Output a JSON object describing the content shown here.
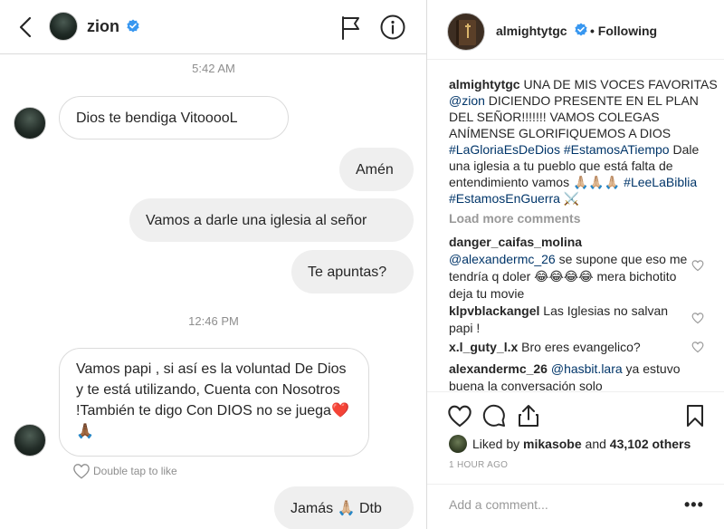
{
  "dm": {
    "header": {
      "username": "zion",
      "back_icon": "chevron-left-icon",
      "flag_icon": "flag-icon",
      "info_icon": "info-icon"
    },
    "timestamps": [
      "5:42 AM",
      "12:46 PM"
    ],
    "messages": [
      {
        "side": "in",
        "text": "Dios te bendiga VitooooL"
      },
      {
        "side": "out",
        "text": "Amén"
      },
      {
        "side": "out",
        "text": "Vamos a darle una iglesia al señor"
      },
      {
        "side": "out",
        "text": "Te apuntas?"
      },
      {
        "side": "in",
        "text": "Vamos papi , si así es la voluntad De Dios y te está utilizando, Cuenta con Nosotros !También te digo Con DIOS no se juega❤️ 🙏🏾"
      },
      {
        "side": "out",
        "text": "Jamás 🙏🏼 Dtb"
      }
    ],
    "double_tap_hint": "Double tap to like"
  },
  "post": {
    "username": "almightytgc",
    "following_label": "• Following",
    "caption_user": "almightytgc",
    "caption_parts": [
      {
        "t": "text",
        "v": " UNA DE MIS VOCES FAVORITAS "
      },
      {
        "t": "link",
        "v": "@zion"
      },
      {
        "t": "text",
        "v": " DICIENDO PRESENTE EN EL PLAN DEL SEÑOR!!!!!!! VAMOS COLEGAS ANÍMENSE GLORIFIQUEMOS A DIOS "
      },
      {
        "t": "link",
        "v": "#LaGloriaEsDeDios"
      },
      {
        "t": "text",
        "v": " "
      },
      {
        "t": "link",
        "v": "#EstamosATiempo"
      },
      {
        "t": "text",
        "v": " Dale una iglesia a tu pueblo que está falta de entendimiento vamos 🙏🏼🙏🏼🙏🏼 "
      },
      {
        "t": "link",
        "v": "#LeeLaBiblia"
      },
      {
        "t": "text",
        "v": " "
      },
      {
        "t": "link",
        "v": "#EstamosEnGuerra"
      },
      {
        "t": "text",
        "v": " ⚔️"
      }
    ],
    "load_more": "Load more comments",
    "comments": [
      {
        "user": "danger_caifas_molina",
        "mention": "@alexandermc_26",
        "text": " se supone que eso me tendría q doler 😂😂😂😂 mera bichotito deja tu movie"
      },
      {
        "user": "klpvblackangel",
        "mention": "",
        "text": " Las Iglesias no salvan papi !"
      },
      {
        "user": "x.l_guty_l.x",
        "mention": "",
        "text": " Bro eres evangelico?"
      },
      {
        "user": "alexandermc_26",
        "mention": "@hasbit.lara",
        "text": " ya estuvo buena la conversación solo"
      }
    ],
    "liked_by_prefix": "Liked by ",
    "liked_by_user": "mikasobe",
    "liked_by_middle": " and ",
    "liked_by_count": "43,102 others",
    "time_ago": "1 HOUR AGO",
    "add_comment_placeholder": "Add a comment...",
    "more_label": "•••"
  },
  "colors": {
    "verified": "#3897f0",
    "link": "#003569",
    "heart": "#ed4956"
  }
}
